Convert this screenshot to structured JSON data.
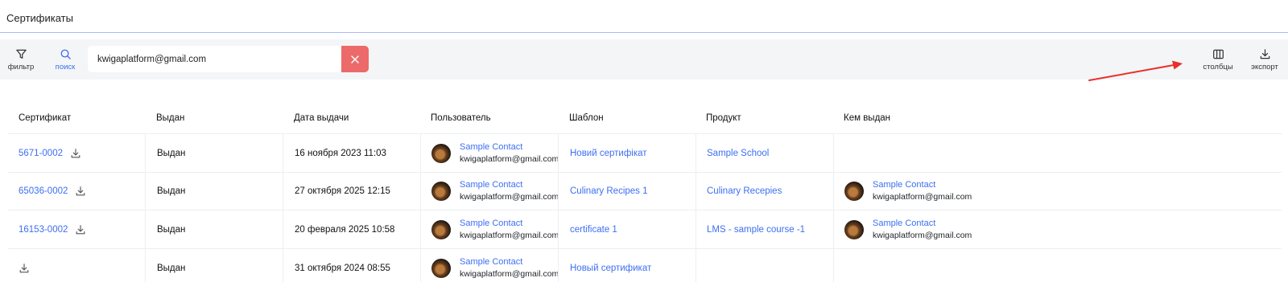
{
  "page": {
    "title": "Сертификаты"
  },
  "toolbar": {
    "filter_label": "фильтр",
    "search_label": "поиск",
    "search_value": "kwigaplatform@gmail.com",
    "columns_label": "столбцы",
    "export_label": "экспорт"
  },
  "table": {
    "columns": [
      "Сертификат",
      "Выдан",
      "Дата выдачи",
      "Пользователь",
      "Шаблон",
      "Продукт",
      "Кем выдан"
    ],
    "rows": [
      {
        "certificate": "5671-0002",
        "status": "Выдан",
        "date": "16 ноября 2023 11:03",
        "user_name": "Sample Contact",
        "user_email": "kwigaplatform@gmail.com",
        "template": "Новий сертифікат",
        "product": "Sample School",
        "issuer_name": "",
        "issuer_email": ""
      },
      {
        "certificate": "65036-0002",
        "status": "Выдан",
        "date": "27 октября 2025 12:15",
        "user_name": "Sample Contact",
        "user_email": "kwigaplatform@gmail.com",
        "template": "Culinary Recipes 1",
        "product": "Culinary Recepies",
        "issuer_name": "Sample Contact",
        "issuer_email": "kwigaplatform@gmail.com"
      },
      {
        "certificate": "16153-0002",
        "status": "Выдан",
        "date": "20 февраля 2025 10:58",
        "user_name": "Sample Contact",
        "user_email": "kwigaplatform@gmail.com",
        "template": "certificate 1",
        "product": "LMS - sample course -1",
        "issuer_name": "Sample Contact",
        "issuer_email": "kwigaplatform@gmail.com"
      },
      {
        "certificate": "",
        "status": "Выдан",
        "date": "31 октября 2024 08:55",
        "user_name": "Sample Contact",
        "user_email": "kwigaplatform@gmail.com",
        "template": "Новый сертификат",
        "product": "",
        "issuer_name": "",
        "issuer_email": ""
      }
    ]
  },
  "icons": {
    "filter": "filter-icon",
    "search": "search-icon",
    "clear": "close-icon",
    "columns": "columns-icon",
    "export": "download-icon",
    "download": "download-icon"
  },
  "colors": {
    "accent": "#3d6ff2",
    "clear_button": "#ec6a6a",
    "toolbar_bg": "#f4f5f7",
    "annotation_arrow": "#e8302a"
  }
}
